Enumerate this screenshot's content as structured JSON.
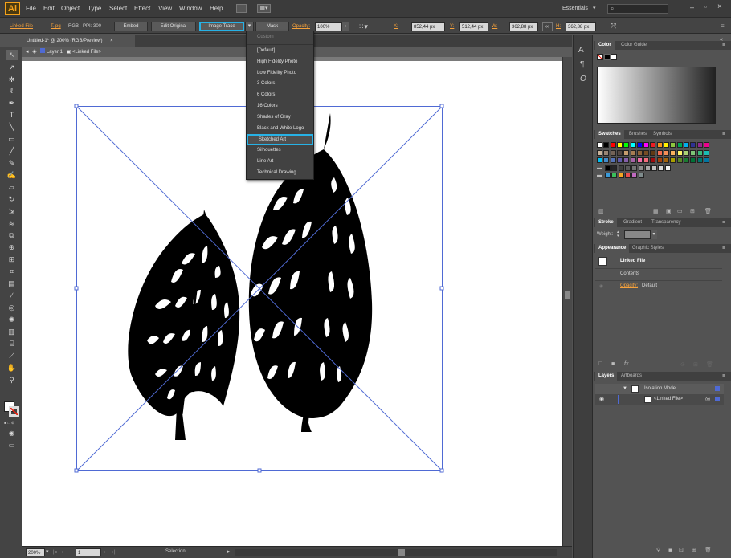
{
  "menubar": {
    "logo": "Ai",
    "items": [
      "File",
      "Edit",
      "Object",
      "Type",
      "Select",
      "Effect",
      "View",
      "Window",
      "Help"
    ],
    "workspace": "Essentials"
  },
  "control_bar": {
    "selection_label": "Linked File",
    "file_type": "T.jpg",
    "color_mode": "RGB",
    "ppi": "PPI: 300",
    "embed": "Embed",
    "edit_original": "Edit Original",
    "image_trace": "Image Trace",
    "mask": "Mask",
    "opacity_label": "Opacity:",
    "opacity_value": "100%",
    "x_label": "X:",
    "x_value": "852,44 px",
    "y_label": "Y:",
    "y_value": "512,44 px",
    "w_label": "W:",
    "w_value": "362,88 px",
    "h_label": "H:",
    "h_value": "362,88 px"
  },
  "document": {
    "tab_title": "Untitled-1* @ 200% (RGB/Preview)",
    "close_glyph": "×",
    "layer": "Layer 1",
    "linked_file": "<Linked File>"
  },
  "trace_presets": {
    "header": "Custom",
    "items": [
      "[Default]",
      "High Fidelity Photo",
      "Low Fidelity Photo",
      "3 Colors",
      "6 Colors",
      "16 Colors",
      "Shades of Gray",
      "Black and White Logo",
      "Sketched Art",
      "Silhouettes",
      "Line Art",
      "Technical Drawing"
    ],
    "highlighted": "Sketched Art"
  },
  "panels": {
    "color": {
      "tabs": [
        "Color",
        "Color Guide"
      ]
    },
    "swatches": {
      "tabs": [
        "Swatches",
        "Brushes",
        "Symbols"
      ]
    },
    "stroke": {
      "tabs": [
        "Stroke",
        "Gradient",
        "Transparency"
      ],
      "weight_label": "Weight:"
    },
    "appearance": {
      "tabs": [
        "Appearance",
        "Graphic Styles"
      ],
      "title": "Linked File",
      "contents": "Contents",
      "opacity_label": "Opacity:",
      "opacity_value": "Default"
    },
    "layers": {
      "tabs": [
        "Layers",
        "Artboards"
      ],
      "rows": [
        "Isolation Mode",
        "<Linked File>"
      ]
    }
  },
  "status": {
    "zoom": "200%",
    "page": "1",
    "tool": "Selection"
  },
  "colors": {
    "accent": "#f6a21b",
    "highlight": "#27b2e6",
    "selection": "#4f6ad4"
  },
  "swatch_rows": [
    [
      "#ffffff",
      "#000000",
      "#ff0000",
      "#ffff00",
      "#00ff00",
      "#00ffff",
      "#0000ff",
      "#ff00ff",
      "#ed1c24",
      "#f7941d",
      "#fff200",
      "#8dc63f",
      "#00a651",
      "#00aeef",
      "#2e3192",
      "#92278f",
      "#ec008c"
    ],
    [
      "#c7b299",
      "#998675",
      "#736357",
      "#534741",
      "#c69c6d",
      "#a67c52",
      "#8c6239",
      "#754c24",
      "#603913",
      "#f26c4f",
      "#f68e56",
      "#fbaf5d",
      "#fff568",
      "#acd373",
      "#7cc576",
      "#3bb878",
      "#1abbb4"
    ],
    [
      "#00bff3",
      "#438ccb",
      "#5574b9",
      "#605ca8",
      "#855fa8",
      "#a763a8",
      "#f06eaa",
      "#f26d7d",
      "#9e0b0f",
      "#a0410d",
      "#a36209",
      "#aba000",
      "#598527",
      "#197b30",
      "#007236",
      "#00746b",
      "#0076a3"
    ],
    [
      "#000000",
      "#262626",
      "#404040",
      "#595959",
      "#737373",
      "#8c8c8c",
      "#a6a6a6",
      "#bfbfbf",
      "#d9d9d9",
      "#f2f2f2"
    ],
    [
      "#3a9ad9",
      "#3abf5a",
      "#f5a623",
      "#e94e4e",
      "#c06ac0",
      "#7f8c8d"
    ]
  ]
}
